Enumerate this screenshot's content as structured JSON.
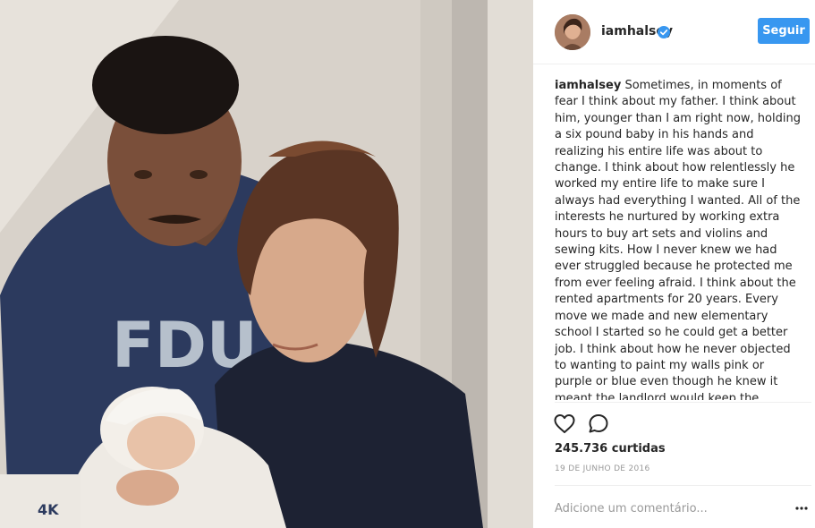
{
  "post": {
    "photo_description_icon": "photo-icon",
    "author": {
      "username": "iamhalsey",
      "verified": true
    },
    "follow_label": "Seguir",
    "caption_text": "Sometimes, in moments of fear I think about my father. I think about him, younger than I am right now, holding a six pound baby in his hands and realizing his entire life was about to change. I think about how relentlessly he worked my entire life to make sure I always had everything I wanted. All of the interests he nurtured by working extra hours to buy art sets and violins and sewing kits. How I never knew we had ever struggled because he protected me from ever feeling afraid. I think about the rented apartments for 20 years. Every move we made and new elementary school I started so he could get a better job. I think about how he never objected to wanting to paint my walls pink or purple or blue even though he knew it meant the landlord would keep the security deposit. I think about all of the things he",
    "likes": "245.736 curtidas",
    "date": "19 DE JUNHO DE 2016",
    "comment_placeholder": "Adicione um comentário...",
    "icons": [
      "heart-icon",
      "comment-icon",
      "more-options-icon",
      "verified-badge-icon"
    ]
  },
  "colors": {
    "follow_button": "#3897f0",
    "verified_badge": "#3897f0",
    "secondary_text": "#999999",
    "primary_text": "#262626",
    "divider": "#efefef"
  }
}
